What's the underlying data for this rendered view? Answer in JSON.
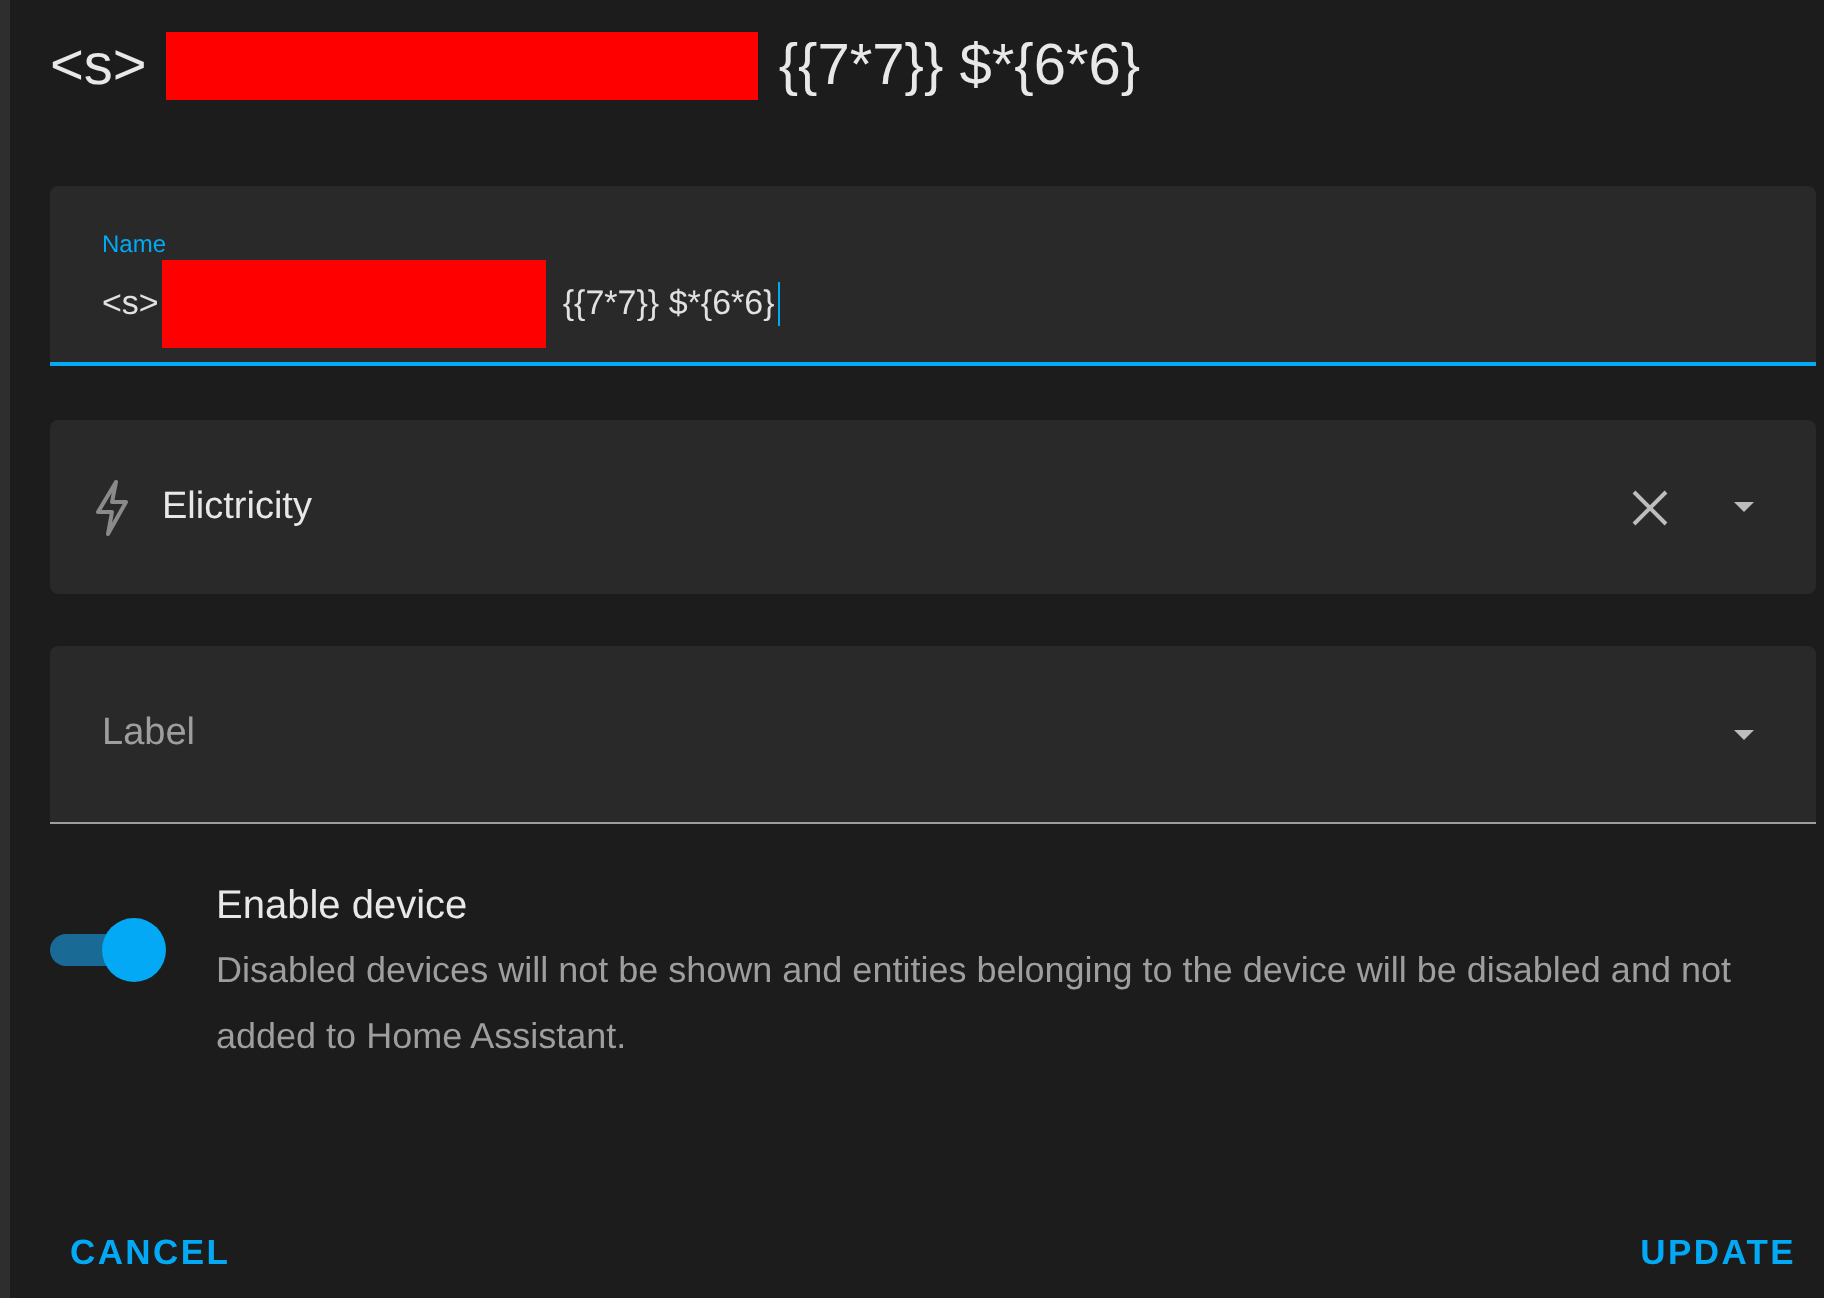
{
  "dialog": {
    "title": {
      "before": "<s>",
      "redacted": true,
      "after": "{{7*7}} $*{6*6}"
    }
  },
  "name_field": {
    "label": "Name",
    "focused": true,
    "value_before": "<s>",
    "redacted": true,
    "value_after": "{{7*7}} $*{6*6}"
  },
  "area_select": {
    "value": "Elictricity",
    "clearable": true
  },
  "label_select": {
    "placeholder": "Label"
  },
  "enable_toggle": {
    "on": true,
    "title": "Enable device",
    "description": "Disabled devices will not be shown and entities belonging to the device will be disabled and not added to Home Assistant."
  },
  "buttons": [
    {
      "label": "CANCEL"
    },
    {
      "label": "UPDATE"
    }
  ]
}
